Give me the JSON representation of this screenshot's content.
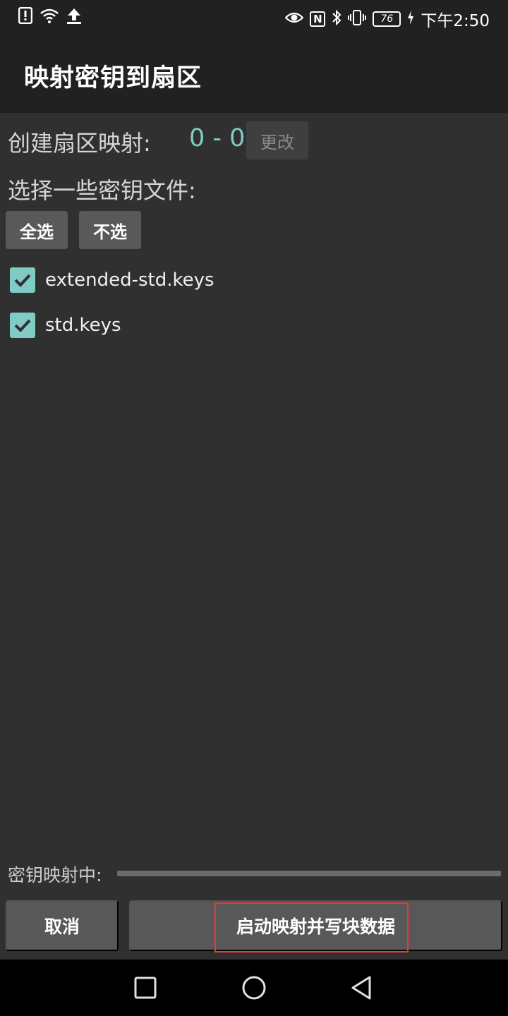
{
  "status_bar": {
    "time": "下午2:50",
    "battery": "76",
    "nfc": "N"
  },
  "app_bar": {
    "title": "映射密钥到扇区"
  },
  "sector_map": {
    "label": "创建扇区映射:",
    "value": "0 - 0",
    "change_button": "更改"
  },
  "key_files": {
    "label": "选择一些密钥文件:",
    "select_all_button": "全选",
    "select_none_button": "不选",
    "items": [
      {
        "name": "extended-std.keys",
        "checked": true
      },
      {
        "name": "std.keys",
        "checked": true
      }
    ]
  },
  "progress": {
    "label": "密钥映射中:",
    "value": 0
  },
  "actions": {
    "cancel_button": "取消",
    "start_button": "启动映射并写块数据"
  },
  "colors": {
    "accent": "#80cbc4",
    "highlight": "#e53935",
    "background": "#303030",
    "toolbar": "#212121"
  }
}
